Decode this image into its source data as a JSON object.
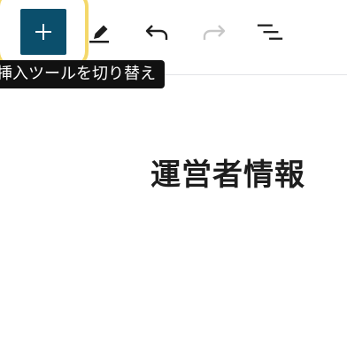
{
  "toolbar": {
    "inserter_icon": "plus-icon",
    "tools_icon": "pencil-icon",
    "undo_icon": "undo-icon",
    "redo_icon": "redo-icon",
    "outline_icon": "list-view-icon",
    "tooltip": "挿入ツールを切り替え"
  },
  "content": {
    "title": "運営者情報"
  },
  "colors": {
    "accent": "#0b4f6c",
    "focus_ring": "#f4d86a",
    "tooltip_bg": "#111111",
    "disabled_icon": "#c7c7c7"
  }
}
